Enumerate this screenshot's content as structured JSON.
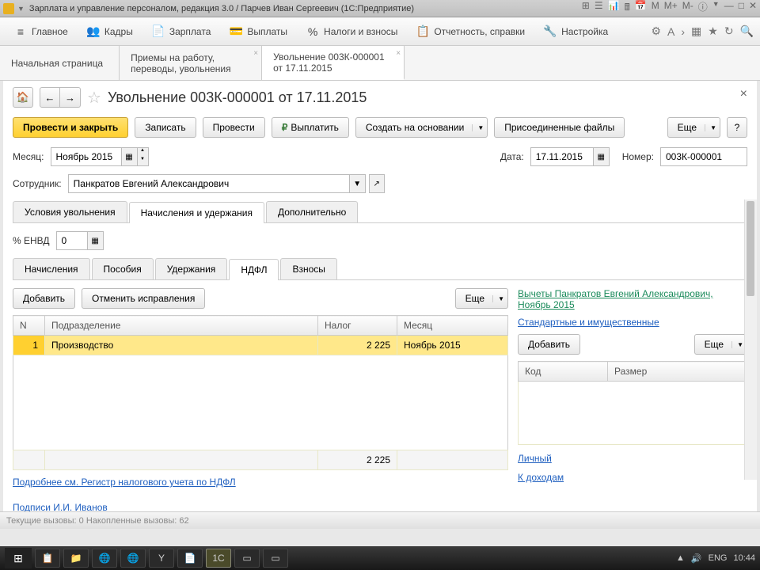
{
  "window": {
    "title": "Зарплата и управление персоналом, редакция 3.0 / Парчев Иван Сергеевич  (1С:Предприятие)"
  },
  "menu": {
    "items": [
      {
        "icon": "≡",
        "label": "Главное"
      },
      {
        "icon": "👥",
        "label": "Кадры"
      },
      {
        "icon": "📄",
        "label": "Зарплата"
      },
      {
        "icon": "💳",
        "label": "Выплаты"
      },
      {
        "icon": "%",
        "label": "Налоги и взносы"
      },
      {
        "icon": "📋",
        "label": "Отчетность, справки"
      },
      {
        "icon": "🔧",
        "label": "Настройка"
      }
    ]
  },
  "doc_tabs": {
    "items": [
      {
        "label": "Начальная страница"
      },
      {
        "label": "Приемы на работу, переводы, увольнения"
      },
      {
        "label": "Увольнение 003К-000001 от 17.11.2015"
      }
    ],
    "active": 2
  },
  "page": {
    "title": "Увольнение 003К-000001 от 17.11.2015",
    "toolbar": {
      "primary": "Провести и закрыть",
      "record": "Записать",
      "post": "Провести",
      "pay": "Выплатить",
      "create_based": "Создать на основании",
      "attached": "Присоединенные файлы",
      "more": "Еще",
      "help": "?"
    },
    "form": {
      "month_label": "Месяц:",
      "month_value": "Ноябрь 2015",
      "date_label": "Дата:",
      "date_value": "17.11.2015",
      "number_label": "Номер:",
      "number_value": "003К-000001",
      "employee_label": "Сотрудник:",
      "employee_value": "Панкратов Евгений Александрович",
      "envd_label": "% ЕНВД",
      "envd_value": "0"
    },
    "tabs1": [
      "Условия увольнения",
      "Начисления и удержания",
      "Дополнительно"
    ],
    "tabs1_active": 1,
    "tabs2": [
      "Начисления",
      "Пособия",
      "Удержания",
      "НДФЛ",
      "Взносы"
    ],
    "tabs2_active": 3,
    "table_toolbar": {
      "add": "Добавить",
      "cancel_fix": "Отменить исправления",
      "more": "Еще"
    },
    "table": {
      "headers": [
        "N",
        "Подразделение",
        "Налог",
        "Месяц"
      ],
      "row": {
        "n": "1",
        "dept": "Производство",
        "tax": "2 225",
        "month": "Ноябрь 2015"
      },
      "footer_tax": "2 225"
    },
    "register_link": "Подробнее см. Регистр налогового учета по НДФЛ",
    "signatures_link": "Подписи  И.И. Иванов",
    "right": {
      "title": "Вычеты Панкратов Евгений Александрович, Ноябрь 2015",
      "std_link": "Стандартные и имущественные",
      "add": "Добавить",
      "more": "Еще",
      "headers": [
        "Код",
        "Размер"
      ],
      "personal": "Личный",
      "income": "К доходам"
    }
  },
  "statusbar": "Текущие вызовы: 0   Накопленные вызовы: 62",
  "taskbar": {
    "lang": "ENG",
    "time": "10:44"
  }
}
